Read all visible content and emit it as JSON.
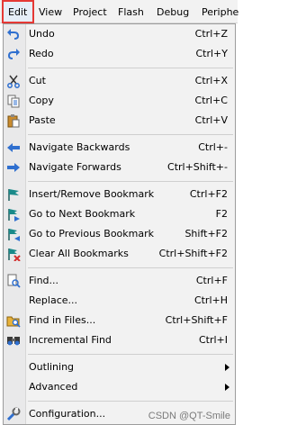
{
  "menubar": {
    "items": [
      "Edit",
      "View",
      "Project",
      "Flash",
      "Debug",
      "Periphe"
    ]
  },
  "menu": {
    "undo": {
      "label": "Undo",
      "shortcut": "Ctrl+Z"
    },
    "redo": {
      "label": "Redo",
      "shortcut": "Ctrl+Y"
    },
    "cut": {
      "label": "Cut",
      "shortcut": "Ctrl+X"
    },
    "copy": {
      "label": "Copy",
      "shortcut": "Ctrl+C"
    },
    "paste": {
      "label": "Paste",
      "shortcut": "Ctrl+V"
    },
    "navigate_backwards": {
      "label": "Navigate Backwards",
      "shortcut": "Ctrl+-"
    },
    "navigate_forwards": {
      "label": "Navigate Forwards",
      "shortcut": "Ctrl+Shift+-"
    },
    "insert_remove_bookmark": {
      "label": "Insert/Remove Bookmark",
      "shortcut": "Ctrl+F2"
    },
    "next_bookmark": {
      "label": "Go to Next Bookmark",
      "shortcut": "F2"
    },
    "previous_bookmark": {
      "label": "Go to Previous Bookmark",
      "shortcut": "Shift+F2"
    },
    "clear_bookmarks": {
      "label": "Clear All Bookmarks",
      "shortcut": "Ctrl+Shift+F2"
    },
    "find": {
      "label": "Find...",
      "shortcut": "Ctrl+F"
    },
    "replace": {
      "label": "Replace...",
      "shortcut": "Ctrl+H"
    },
    "find_in_files": {
      "label": "Find in Files...",
      "shortcut": "Ctrl+Shift+F"
    },
    "incremental_find": {
      "label": "Incremental Find",
      "shortcut": "Ctrl+I"
    },
    "outlining": {
      "label": "Outlining"
    },
    "advanced": {
      "label": "Advanced"
    },
    "configuration": {
      "label": "Configuration..."
    }
  },
  "watermark": "CSDN @QT-Smile",
  "colors": {
    "highlight_border": "#e53935",
    "menu_background": "#f2f2f2",
    "icon_gutter": "#e9e9ea",
    "icon_blue": "#2f6fcf",
    "icon_teal": "#1a8a8a"
  }
}
